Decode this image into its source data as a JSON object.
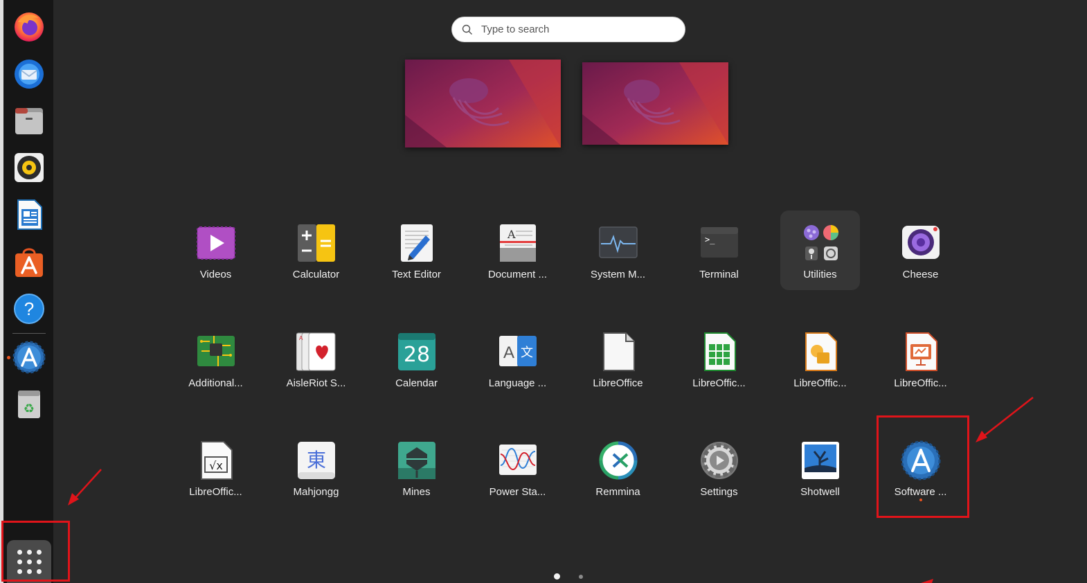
{
  "dock": {
    "items": [
      {
        "name": "firefox-icon"
      },
      {
        "name": "thunderbird-icon"
      },
      {
        "name": "files-icon"
      },
      {
        "name": "rhythmbox-icon"
      },
      {
        "name": "libreoffice-writer-icon"
      },
      {
        "name": "ubuntu-software-icon"
      },
      {
        "name": "help-icon"
      },
      {
        "name": "software-updater-icon"
      },
      {
        "name": "trash-icon"
      }
    ],
    "show_apps_icon": "grid-icon"
  },
  "search": {
    "placeholder": "Type to search"
  },
  "apps": [
    {
      "label": "Videos",
      "icon": "videos-icon"
    },
    {
      "label": "Calculator",
      "icon": "calculator-icon"
    },
    {
      "label": "Text Editor",
      "icon": "text-editor-icon"
    },
    {
      "label": "Document ...",
      "icon": "document-viewer-icon"
    },
    {
      "label": "System M...",
      "icon": "system-monitor-icon"
    },
    {
      "label": "Terminal",
      "icon": "terminal-icon"
    },
    {
      "label": "Utilities",
      "icon": "utilities-folder-icon"
    },
    {
      "label": "Cheese",
      "icon": "cheese-icon"
    },
    {
      "label": "Additional...",
      "icon": "additional-drivers-icon"
    },
    {
      "label": "AisleRiot S...",
      "icon": "aisleriot-icon"
    },
    {
      "label": "Calendar",
      "icon": "calendar-icon",
      "day": "28"
    },
    {
      "label": "Language ...",
      "icon": "language-support-icon"
    },
    {
      "label": "LibreOffice",
      "icon": "libreoffice-icon"
    },
    {
      "label": "LibreOffic...",
      "icon": "libreoffice-calc-icon"
    },
    {
      "label": "LibreOffic...",
      "icon": "libreoffice-draw-icon"
    },
    {
      "label": "LibreOffic...",
      "icon": "libreoffice-impress-icon"
    },
    {
      "label": "LibreOffic...",
      "icon": "libreoffice-math-icon"
    },
    {
      "label": "Mahjongg",
      "icon": "mahjongg-icon"
    },
    {
      "label": "Mines",
      "icon": "mines-icon"
    },
    {
      "label": "Power Sta...",
      "icon": "power-statistics-icon"
    },
    {
      "label": "Remmina",
      "icon": "remmina-icon"
    },
    {
      "label": "Settings",
      "icon": "settings-icon"
    },
    {
      "label": "Shotwell",
      "icon": "shotwell-icon"
    },
    {
      "label": "Software ...",
      "icon": "software-updater-icon"
    }
  ],
  "pages": {
    "count": 2,
    "current": 1
  },
  "colors": {
    "accent": "#e95420",
    "annotation": "#e0141a",
    "background": "#282828"
  }
}
